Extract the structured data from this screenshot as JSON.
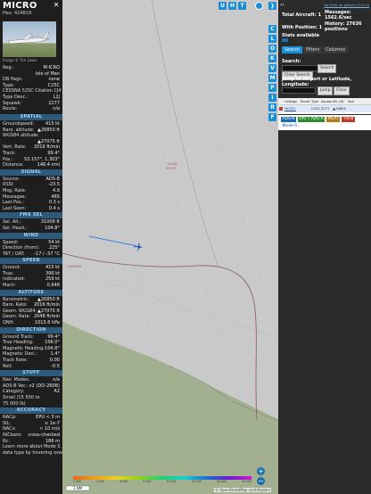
{
  "aircraft": {
    "callsign": "MICRO",
    "hex_label": "Hex:",
    "hex": "424B18",
    "photo_credit": "Image © Tim Lowe",
    "reg": [
      {
        "k": "Reg.:",
        "v": "M-ICRO"
      },
      {
        "k": "",
        "v": "Isle of Man"
      },
      {
        "k": "DB flags:",
        "v": "none"
      },
      {
        "k": "Type:",
        "v": "C25C"
      },
      {
        "k": "CESSNA 525C Citation CJ4",
        "v": ""
      },
      {
        "k": "Type Desc.:",
        "v": "L2J"
      },
      {
        "k": "Squawk:",
        "v": "2277"
      },
      {
        "k": "Route:",
        "v": "n/a"
      }
    ]
  },
  "sections": [
    {
      "title": "SPATIAL",
      "rows": [
        {
          "k": "Groundspeed:",
          "v": "415 kt"
        },
        {
          "k": "Baro. altitude:",
          "v": "▲26850 ft"
        },
        {
          "k": "WGS84 altitude:",
          "v": ""
        },
        {
          "k": "",
          "v": "▲27075 ft"
        },
        {
          "k": "Vert. Rate:",
          "v": "2016 ft/min"
        },
        {
          "k": "Track:",
          "v": "99.4°"
        },
        {
          "k": "Pos.:",
          "v": "53.157°, 1.303°"
        },
        {
          "k": "Distance:",
          "v": "146.4 nmi"
        }
      ]
    },
    {
      "title": "SIGNAL",
      "rows": [
        {
          "k": "Source:",
          "v": "ADS-B"
        },
        {
          "k": "RSSI:",
          "v": "-23.5"
        },
        {
          "k": "Msg. Rate:",
          "v": "4.6"
        },
        {
          "k": "Messages:",
          "v": "485"
        },
        {
          "k": "Last Pos.:",
          "v": "0.3 s"
        },
        {
          "k": "Last Seen:",
          "v": "0.4 s"
        }
      ]
    },
    {
      "title": "FMS SEL",
      "rows": [
        {
          "k": "Sel. Alt.:",
          "v": "31008 ft"
        },
        {
          "k": "Sel. Head.:",
          "v": "104.8°"
        }
      ]
    },
    {
      "title": "WIND",
      "rows": [
        {
          "k": "Speed:",
          "v": "54 kt"
        },
        {
          "k": "Direction (from):",
          "v": "225°"
        },
        {
          "k": "TAT / OAT:",
          "v": "-17 / -37 °C"
        }
      ]
    },
    {
      "title": "SPEED",
      "rows": [
        {
          "k": "Ground:",
          "v": "415 kt"
        },
        {
          "k": "True:",
          "v": "396 kt"
        },
        {
          "k": "Indicated:",
          "v": "259 kt"
        },
        {
          "k": "Mach:",
          "v": "0.648"
        }
      ]
    },
    {
      "title": "ALTITUDE",
      "rows": [
        {
          "k": "Barometric:",
          "v": "▲26850 ft"
        },
        {
          "k": "Baro. Rate:",
          "v": "2016 ft/min"
        },
        {
          "k": "Geom. WGS84:",
          "v": "▲27075 ft"
        },
        {
          "k": "Geom. Rate:",
          "v": "2048 ft/min"
        },
        {
          "k": "QNH:",
          "v": "1013.6 hPa"
        }
      ]
    },
    {
      "title": "DIRECTION",
      "rows": [
        {
          "k": "Ground Track:",
          "v": "99.4°"
        },
        {
          "k": "True Heading:",
          "v": "106.0°"
        },
        {
          "k": "Magnetic Heading:",
          "v": "104.8°"
        },
        {
          "k": "Magnetic Decl.:",
          "v": "1.4°"
        },
        {
          "k": "Track Rate:",
          "v": "0.00"
        },
        {
          "k": "Roll:",
          "v": "-0.5"
        }
      ]
    },
    {
      "title": "STUFF",
      "rows": [
        {
          "k": "Nav. Modes:",
          "v": "n/a"
        },
        {
          "k": "ADS-B Ver.:",
          "v": "v2 (DO-260B)"
        },
        {
          "k": "Category:",
          "v": "A2"
        },
        {
          "k": "Small (15 500 to",
          "v": ""
        },
        {
          "k": "75 000 lb)",
          "v": ""
        }
      ]
    },
    {
      "title": "ACCURACY",
      "rows": [
        {
          "k": "NACp:",
          "v": "EPU < 3 m"
        },
        {
          "k": "SIL:",
          "v": "≤ 1e-7"
        },
        {
          "k": "NACv:",
          "v": "< 10 m/s"
        },
        {
          "k": "NICbaro:",
          "v": "cross-checked"
        },
        {
          "k": "Rc:",
          "v": "186 m"
        },
        {
          "k": "Learn more about Mode S",
          "v": ""
        },
        {
          "k": "data type by hovering over",
          "v": ""
        }
      ]
    }
  ],
  "map": {
    "top_buttons": [
      "U",
      "H",
      "T"
    ],
    "side_buttons": [
      "C",
      "L",
      "O",
      "K",
      "V",
      "M",
      "P",
      "I",
      "R",
      "F"
    ],
    "scale_label": "1 NM",
    "attribution": "© OpenStreetMap contributors",
    "zoom_in": "+",
    "zoom_out": "−",
    "legend_ticks": [
      "2 000",
      "4 000",
      "6 000",
      "8 000",
      "10 000",
      "20 000",
      "30 000",
      "40 000"
    ]
  },
  "right": {
    "version": "tar1090 on github (3.11.0)",
    "total_label": "Total Aircraft:",
    "total": "1",
    "with_pos_label": "With Position:",
    "with_pos": "1",
    "messages_label": "Messages:",
    "messages": "1562.6/sec",
    "history_label": "History:",
    "history": "27636 positions",
    "stats_label": "Stats available",
    "tabs": [
      "Search",
      "Filters",
      "Columns"
    ],
    "search_label": "Search:",
    "search_btn": "Search",
    "clear_search": "Clear Search",
    "jump_label": "Jump to Airport or Latitude, Longitude:",
    "jump_btn": "Jump",
    "clear_btn": "Clear",
    "columns": [
      "",
      "Callsign",
      "Route",
      "Type",
      "Squawk",
      "Alt. (ft)",
      "Spd"
    ],
    "row": [
      "",
      "MICRO",
      "",
      "C25C",
      "2277",
      "▲26850",
      ""
    ],
    "badges": [
      "ADS-B",
      "UAT / ADS-R",
      "MLAT",
      "TIS-B",
      "Mode-S"
    ],
    "colors": {
      "adsb": "#1a6fb0",
      "uat": "#2e8b2e",
      "mlat": "#b87a1a",
      "tisb": "#c0392b"
    }
  }
}
